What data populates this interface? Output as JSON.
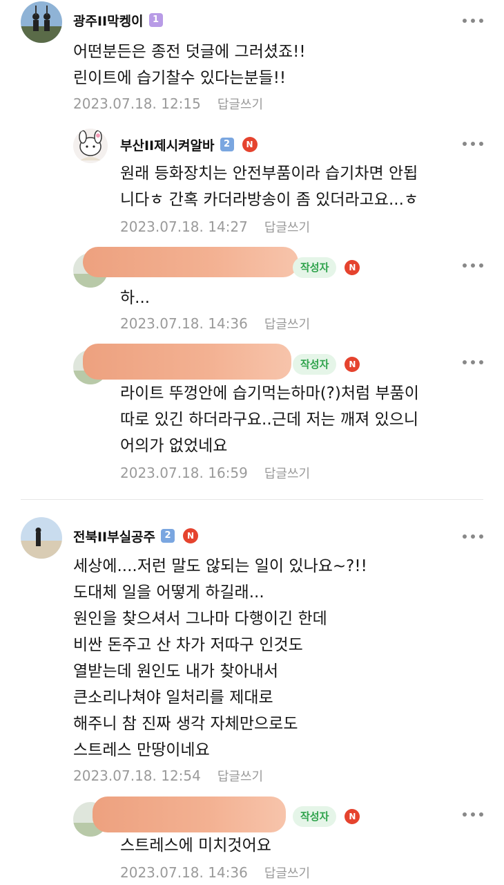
{
  "comments": [
    {
      "nick": "광주II막켕이",
      "level": "1",
      "text": [
        "어떤분든은 종전 덧글에 그러셨죠!!",
        "린이트에 습기찰수 있다는분들!!"
      ],
      "date": "2023.07.18. 12:15",
      "reply": "답글쓰기"
    },
    {
      "nick": "부산II제시켜알바",
      "level": "2",
      "nbadge": "N",
      "text": [
        "원래 등화장치는 안전부품이라 습기차면 안됩",
        "니다ㅎ 간혹 카더라방송이 좀 있더라고요...ㅎ"
      ],
      "date": "2023.07.18. 14:27",
      "reply": "답글쓰기"
    },
    {
      "author_badge": "작성자",
      "nbadge": "N",
      "text": [
        "하..."
      ],
      "date": "2023.07.18. 14:36",
      "reply": "답글쓰기"
    },
    {
      "author_badge": "작성자",
      "nbadge": "N",
      "text": [
        "라이트 뚜껑안에 습기먹는하마(?)처럼 부품이",
        "따로 있긴 하더라구요..근데 저는 깨져 있으니",
        "어의가 없었네요"
      ],
      "date": "2023.07.18. 16:59",
      "reply": "답글쓰기"
    },
    {
      "nick": "전북II부실공주",
      "level": "2",
      "nbadge": "N",
      "text": [
        "세상에....저런 말도 않되는 일이 있나요~?!!",
        "도대체 일을 어떻게 하길래...",
        "원인을 찾으셔서 그나마 다행이긴 한데",
        "비싼 돈주고 산 차가 저따구 인것도",
        "열받는데 원인도 내가 찾아내서",
        "큰소리나쳐야 일처리를 제대로",
        "해주니 참 진짜 생각 자체만으로도",
        "스트레스 만땅이네요"
      ],
      "date": "2023.07.18. 12:54",
      "reply": "답글쓰기"
    },
    {
      "author_badge": "작성자",
      "nbadge": "N",
      "text": [
        "스트레스에 미치것어요"
      ],
      "date": "2023.07.18. 14:36",
      "reply": "답글쓰기"
    }
  ],
  "colors": {
    "level1": "#b89be6",
    "level2": "#7aa6e0",
    "new_badge": "#e5432e",
    "author_badge_bg": "#e5f5e8",
    "author_badge_text": "#2fa34c",
    "redaction": "#f0a585",
    "meta_text": "#9a9a9a"
  },
  "icons": [
    "more-options-icon",
    "new-badge-icon",
    "level-badge-icon",
    "avatar"
  ]
}
